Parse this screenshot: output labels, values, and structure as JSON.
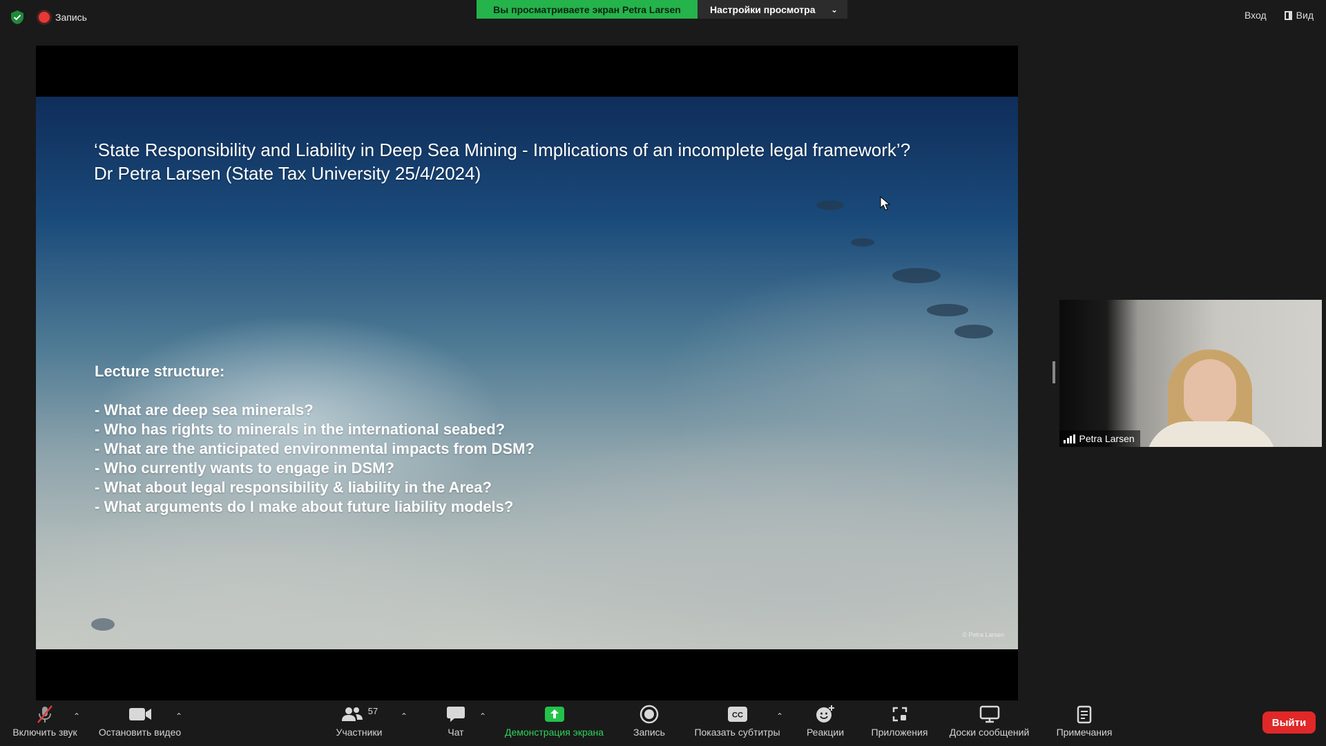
{
  "topbar": {
    "recording_label": "Запись",
    "viewing_banner": "Вы просматриваете экран Petra Larsen",
    "view_settings": "Настройки просмотра",
    "signin": "Вход",
    "view": "Вид"
  },
  "slide": {
    "title_line1": "‘State Responsibility and Liability in Deep Sea Mining - Implications of an incomplete legal framework’?",
    "title_line2": "Dr Petra Larsen (State Tax University 25/4/2024)",
    "structure_heading": "Lecture structure:",
    "structure_items": [
      "- What are deep sea minerals?",
      "- Who has rights to minerals in the international seabed?",
      "- What are the anticipated environmental impacts from DSM?",
      "- Who currently wants to engage in DSM?",
      "- What about legal responsibility & liability in the Area?",
      "- What arguments do I make about future liability models?"
    ],
    "copyright": "© Petra Larsen"
  },
  "self_video": {
    "name": "Petra Larsen"
  },
  "toolbar": {
    "unmute": "Включить звук",
    "stop_video": "Остановить видео",
    "participants": "Участники",
    "participants_count": "57",
    "chat": "Чат",
    "share_screen": "Демонстрация экрана",
    "record": "Запись",
    "captions": "Показать субтитры",
    "reactions": "Реакции",
    "apps": "Приложения",
    "whiteboards": "Доски сообщений",
    "notes": "Примечания",
    "leave": "Выйти"
  },
  "colors": {
    "share_green": "#25b34b",
    "leave_red": "#e02828",
    "toolbar_bg": "#1a1a1a"
  }
}
